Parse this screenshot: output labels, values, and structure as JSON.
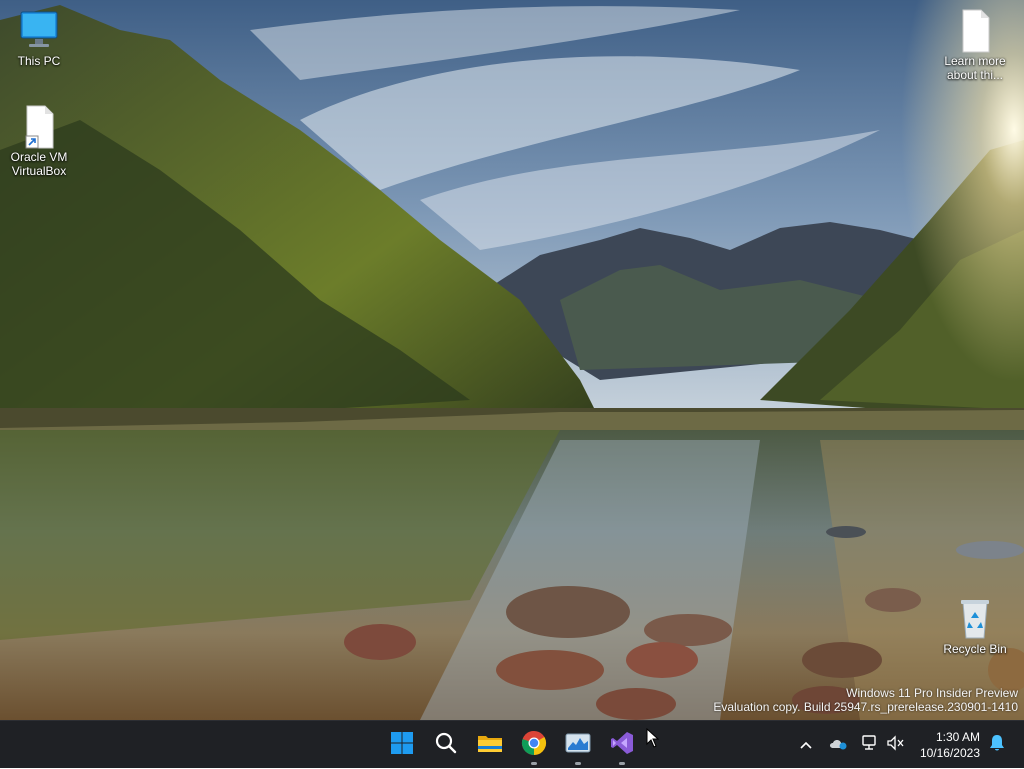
{
  "desktop": {
    "icons": [
      {
        "label": "This PC",
        "icon": "monitor-icon"
      },
      {
        "label": "Oracle VM VirtualBox",
        "icon": "shortcut-file-icon"
      },
      {
        "label": "Learn more about thi...",
        "icon": "file-icon"
      },
      {
        "label": "Recycle Bin",
        "icon": "recycle-bin-icon"
      }
    ],
    "watermark": {
      "line1": "Windows 11 Pro Insider Preview",
      "line2": "Evaluation copy. Build 25947.rs_prerelease.230901-1410"
    }
  },
  "taskbar": {
    "apps": [
      {
        "name": "Start",
        "icon": "windows-start-icon"
      },
      {
        "name": "Search",
        "icon": "search-icon"
      },
      {
        "name": "File Explorer",
        "icon": "folder-icon"
      },
      {
        "name": "Google Chrome",
        "icon": "chrome-icon"
      },
      {
        "name": "Task Manager",
        "icon": "task-manager-icon"
      },
      {
        "name": "Visual Studio",
        "icon": "visual-studio-icon"
      }
    ],
    "tray": {
      "icons": [
        "chevron-up-icon",
        "onedrive-icon",
        "network-icon",
        "volume-muted-icon",
        "notification-bell-icon"
      ],
      "time": "1:30 AM",
      "date": "10/16/2023"
    }
  },
  "colors": {
    "taskbar_bg": "#1f2125",
    "accent": "#0078d4"
  }
}
